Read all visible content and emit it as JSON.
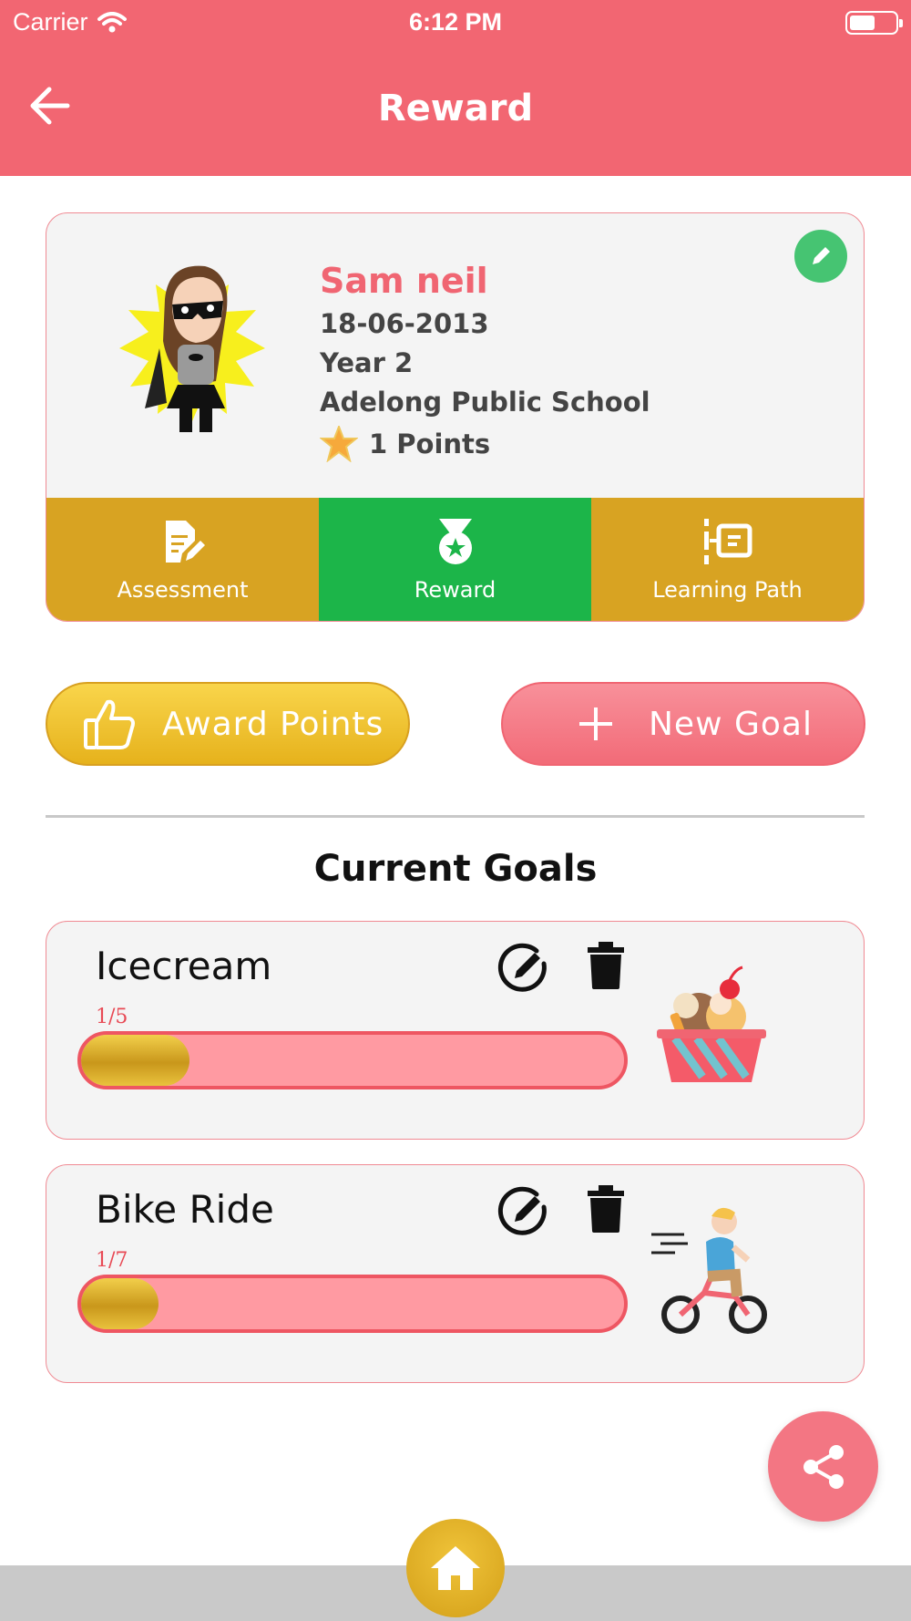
{
  "status_bar": {
    "carrier": "Carrier",
    "time": "6:12 PM"
  },
  "nav": {
    "title": "Reward",
    "back_icon": "arrow-left-icon"
  },
  "profile": {
    "name": "Sam neil",
    "dob": "18-06-2013",
    "year": "Year 2",
    "school": "Adelong Public School",
    "points": "1 Points",
    "edit_icon": "pencil-icon"
  },
  "tabs": [
    {
      "label": "Assessment",
      "icon": "document-edit-icon",
      "active": false
    },
    {
      "label": "Reward",
      "icon": "medal-icon",
      "active": true
    },
    {
      "label": "Learning Path",
      "icon": "learning-path-icon",
      "active": false
    }
  ],
  "actions": {
    "award_label": "Award Points",
    "new_goal_label": "New Goal"
  },
  "section": {
    "title": "Current Goals"
  },
  "goals": [
    {
      "name": "Icecream",
      "progress_text": "1/5",
      "progress": 0.2,
      "image": "icecream-basket"
    },
    {
      "name": "Bike Ride",
      "progress_text": "1/7",
      "progress": 0.142857,
      "image": "bike-rider"
    }
  ],
  "colors": {
    "header": "#f26672",
    "tab_gold": "#d8a322",
    "tab_active": "#1cb549",
    "accent_pink": "#f06572"
  }
}
